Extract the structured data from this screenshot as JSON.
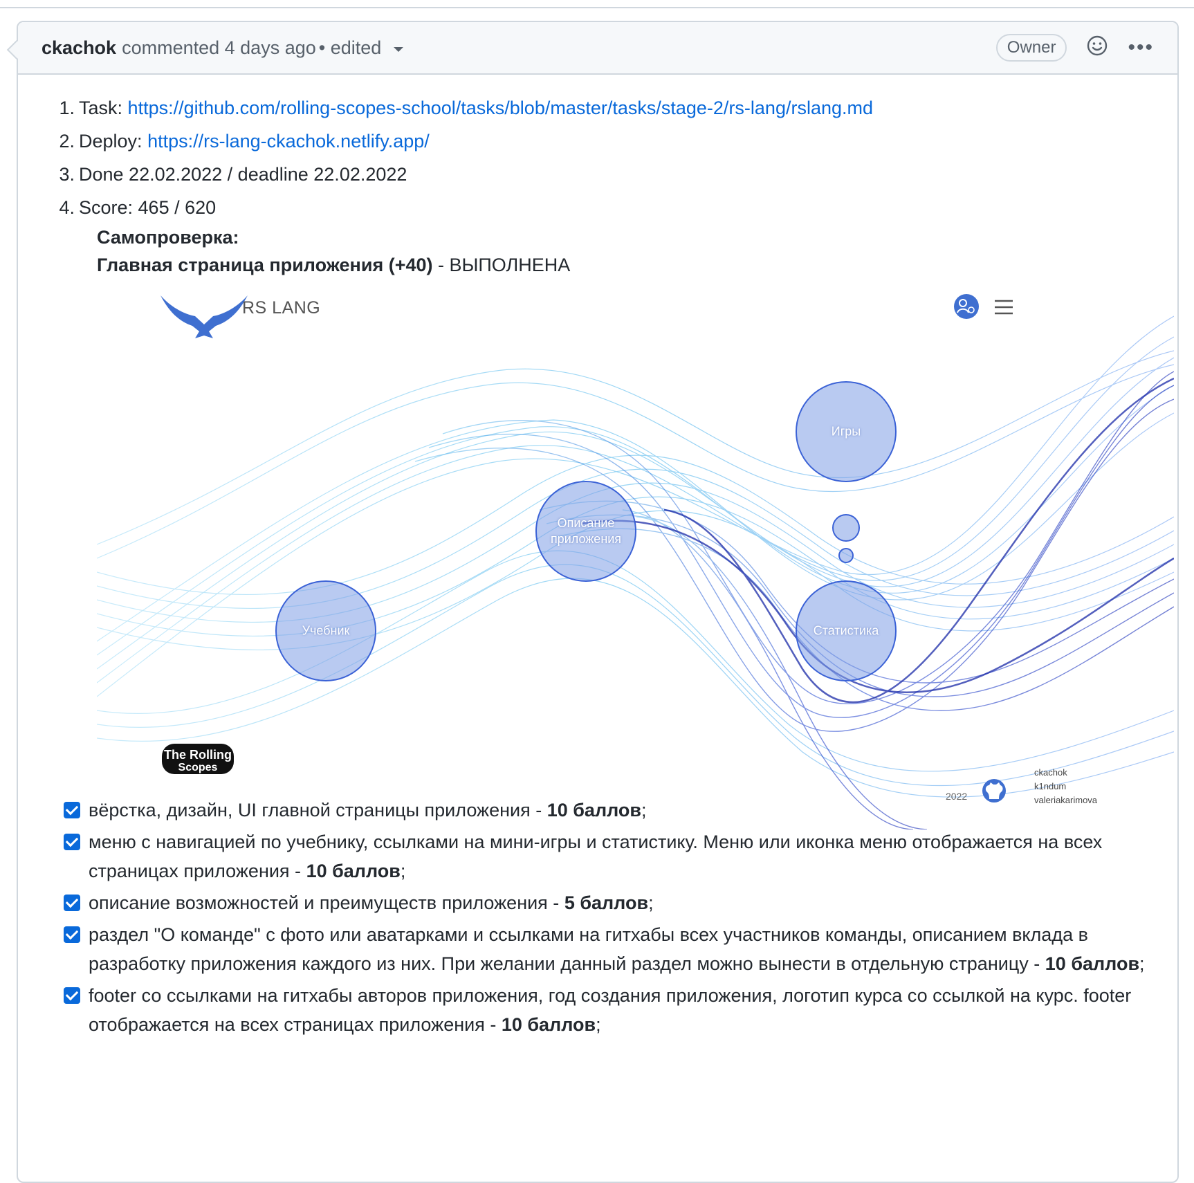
{
  "comment": {
    "author": "ckachok",
    "meta": "commented 4 days ago",
    "edited": "• edited",
    "role_badge": "Owner",
    "list": [
      {
        "num": "1.",
        "label": "Task:",
        "link": "https://github.com/rolling-scopes-school/tasks/blob/master/tasks/stage-2/rs-lang/rslang.md"
      },
      {
        "num": "2.",
        "label": "Deploy:",
        "link": "https://rs-lang-ckachok.netlify.app/"
      },
      {
        "num": "3.",
        "text": "Done 22.02.2022 / deadline 22.02.2022"
      },
      {
        "num": "4.",
        "text": "Score: 465 / 620"
      }
    ],
    "selfcheck_title": "Самопроверка:",
    "section_title": "Главная страница приложения (+40)",
    "section_status": " - ВЫПОЛНЕНА"
  },
  "screenshot": {
    "brand": "RS LANG",
    "bubbles": {
      "games": "Игры",
      "about_line1": "Описание",
      "about_line2": "приложения",
      "textbook": "Учебник",
      "stats": "Статистика"
    },
    "footer_year": "2022",
    "footer_authors": [
      "ckachok",
      "k1ndum",
      "valeriakarimova"
    ],
    "course_logo_line1": "The Rolling",
    "course_logo_line2": "Scopes",
    "colors": {
      "bubble": "#7f9fe6",
      "wave_light": "#5ec3ef",
      "wave_dark": "#1a2fb8"
    }
  },
  "checklist": [
    {
      "text": "вёрстка, дизайн, UI главной страницы приложения - ",
      "bold": "10 баллов",
      "end": ";"
    },
    {
      "text": "меню с навигацией по учебнику, ссылками на мини-игры и статистику. Меню или иконка меню отображается на всех страницах приложения - ",
      "bold": "10 баллов",
      "end": ";"
    },
    {
      "text": "описание возможностей и преимуществ приложения - ",
      "bold": "5 баллов",
      "end": ";"
    },
    {
      "text": "раздел \"О команде\" с фото или аватарками и ссылками на гитхабы всех участников команды, описанием вклада в разработку приложения каждого из них. При желании данный раздел можно вынести в отдельную страницу - ",
      "bold": "10 баллов",
      "end": ";"
    },
    {
      "text": "footer со ссылками на гитхабы авторов приложения, год создания приложения, логотип курса со ссылкой на курс. footer отображается на всех страницах приложения - ",
      "bold": "10 баллов",
      "end": ";"
    }
  ]
}
